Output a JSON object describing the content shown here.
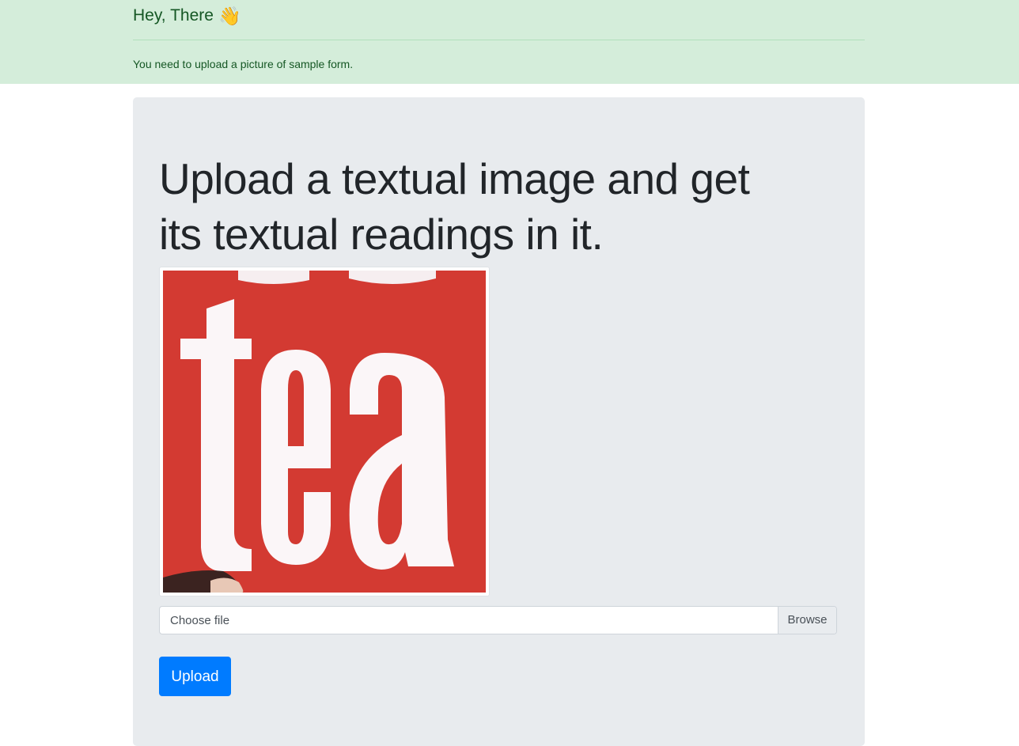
{
  "alert": {
    "heading": "Hey, There",
    "emoji": "👋",
    "message": "You need to upload a picture of sample form."
  },
  "main": {
    "headline": "Upload a textual image and get its textual readings in it.",
    "image_text": "tea",
    "file_input": {
      "placeholder": "Choose file",
      "browse_label": "Browse"
    },
    "upload_label": "Upload"
  },
  "colors": {
    "alert_bg": "#d4edda",
    "alert_text": "#155724",
    "jumbotron_bg": "#e9ecef",
    "primary": "#007bff",
    "image_red": "#d33a32"
  }
}
